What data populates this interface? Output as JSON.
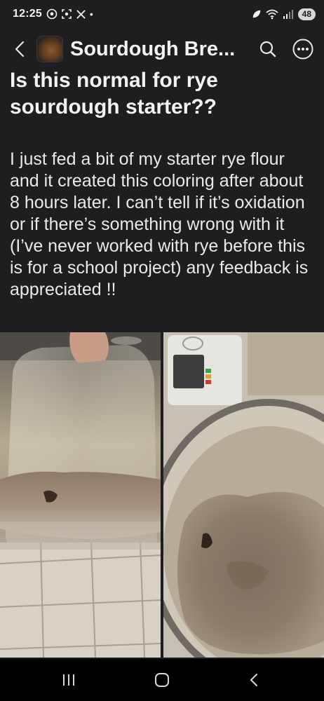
{
  "status_bar": {
    "time": "12:25",
    "dot": "•",
    "battery": "48",
    "icons": [
      "soccer-ball-icon",
      "screenshot-icon",
      "x-logo-icon",
      "leaf-icon",
      "wifi-icon",
      "signal-icon",
      "battery-icon"
    ]
  },
  "header": {
    "community_name": "Sourdough Bre...",
    "icons": [
      "back-arrow-icon",
      "search-icon",
      "more-options-icon"
    ]
  },
  "post": {
    "title": "Is this normal for rye sourdough starter??",
    "body": "I just fed a bit of my starter rye flour and it created this coloring after about 8 hours later. I can’t tell if it’s oxidation or if there’s something wrong with it (I’ve never worked with rye before this is for a school project) any feedback is appreciated !!"
  },
  "navigation": {
    "icons": [
      "recent-apps-icon",
      "home-icon",
      "back-icon"
    ]
  },
  "colors": {
    "background": "#1e1e21",
    "text": "#eceae6",
    "nav_bar": "#000000"
  }
}
